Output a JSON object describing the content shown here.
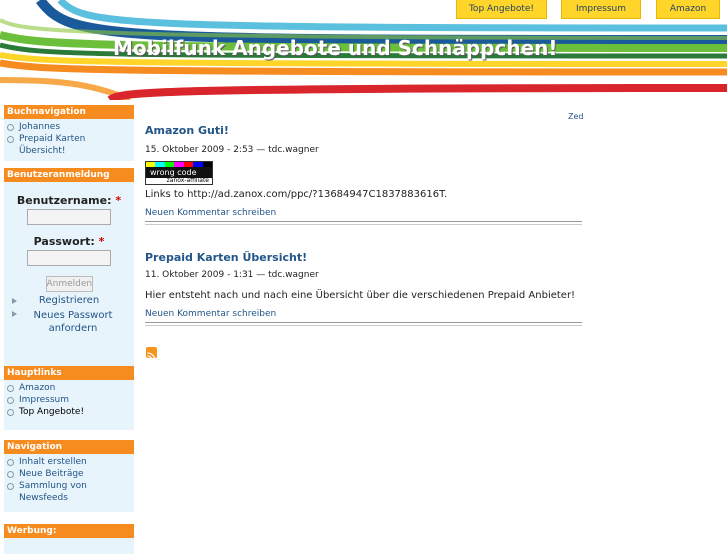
{
  "header": {
    "site_title": "Mobilfunk Angebote und Schnäppchen!",
    "tabs": [
      "Top Angebote!",
      "Impressum",
      "Amazon"
    ]
  },
  "zed_link": "Zed",
  "sidebar": {
    "book_nav": {
      "title": "Buchnavigation",
      "items": [
        "Johannes",
        "Prepaid Karten Übersicht!"
      ]
    },
    "login": {
      "title": "Benutzeranmeldung",
      "username_label": "Benutzername:",
      "password_label": "Passwort:",
      "required_mark": "*",
      "submit": "Anmelden",
      "links": [
        "Registrieren",
        "Neues Passwort anfordern"
      ]
    },
    "main_links": {
      "title": "Hauptlinks",
      "items": [
        "Amazon",
        "Impressum",
        "Top Angebote!"
      ]
    },
    "navigation": {
      "title": "Navigation",
      "items": [
        "Inhalt erstellen",
        "Neue Beiträge",
        "Sammlung von Newsfeeds"
      ]
    },
    "ads": {
      "title": "Werbung:"
    }
  },
  "posts": [
    {
      "title": "Amazon Guti!",
      "meta": "15. Oktober 2009 - 2:53 — tdc.wagner",
      "image_top_text": "wrong code",
      "image_bottom_text": "zanox-affiliate",
      "body": "Links to http://ad.zanox.com/ppc/?13684947C1837883616T.",
      "comment_link": "Neuen Kommentar schreiben"
    },
    {
      "title": "Prepaid Karten Übersicht!",
      "meta": "11. Oktober 2009 - 1:31 — tdc.wagner",
      "body": "Hier entsteht nach und nach eine Übersicht über die verschiedenen Prepaid Anbieter!",
      "comment_link": "Neuen Kommentar schreiben"
    }
  ],
  "colors": {
    "accent_orange": "#f68b1f",
    "sidebar_bg": "#e8f4fb",
    "link_blue": "#225588",
    "tab_yellow": "#ffd52a"
  }
}
